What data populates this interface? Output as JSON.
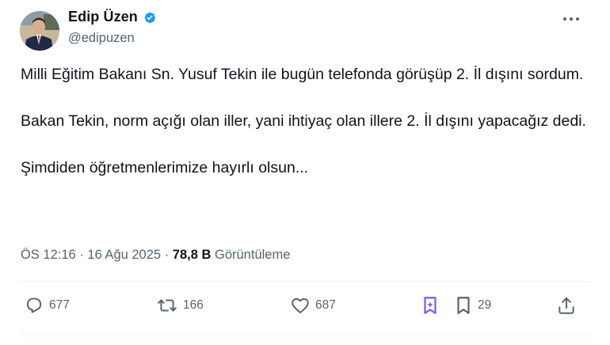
{
  "author": {
    "display_name": "Edip Üzen",
    "handle": "@edipuzen",
    "verified": true
  },
  "tweet": {
    "paragraphs": [
      "Milli Eğitim Bakanı Sn. Yusuf Tekin ile bugün telefonda görüşüp 2. İl dışını sordum.",
      "Bakan Tekin, norm açığı olan iller, yani ihtiyaç olan illere 2. İl dışını yapacağız dedi.",
      "Şimdiden öğretmenlerimize hayırlı olsun..."
    ],
    "time": "ÖS 12:16",
    "separator": "·",
    "date": "16 Ağu 2025",
    "views_count": "78,8 B",
    "views_label": "Görüntüleme"
  },
  "actions": {
    "replies": "677",
    "reposts": "166",
    "likes": "687",
    "bookmarks": "29"
  },
  "icons": {
    "verified": "verified-badge-icon",
    "more": "more-options-icon",
    "reply": "reply-icon",
    "repost": "repost-icon",
    "like": "heart-icon",
    "grok": "grok-icon",
    "bookmark": "bookmark-icon",
    "share": "share-icon"
  },
  "colors": {
    "text_primary": "#0f1419",
    "text_secondary": "#536471",
    "verified_blue": "#1d9bf0",
    "grok_purple": "#7856ff"
  }
}
